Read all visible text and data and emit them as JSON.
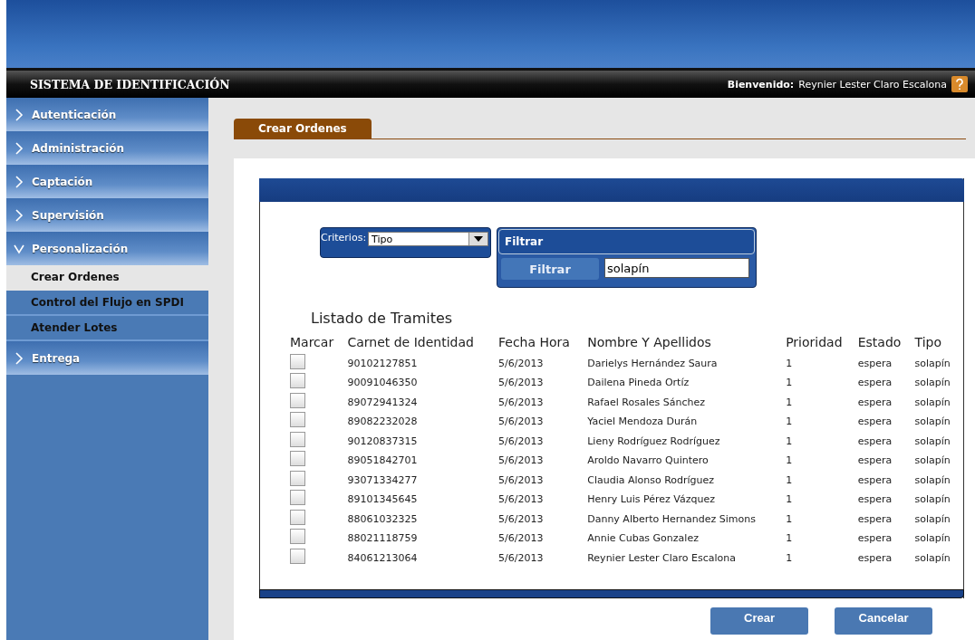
{
  "header": {
    "title": "SISTEMA DE IDENTIFICACIÓN",
    "welcome_label": "Bienvenido:",
    "user": "Reynier Lester Claro Escalona"
  },
  "sidebar": {
    "items": [
      {
        "label": "Autenticación",
        "expanded": false
      },
      {
        "label": "Administración",
        "expanded": false
      },
      {
        "label": "Captación",
        "expanded": false
      },
      {
        "label": "Supervisión",
        "expanded": false
      },
      {
        "label": "Personalización",
        "expanded": true,
        "children": [
          {
            "label": "Crear Ordenes",
            "selected": true
          },
          {
            "label": "Control del Flujo en SPDI",
            "selected": false
          },
          {
            "label": "Atender Lotes",
            "selected": false
          }
        ]
      },
      {
        "label": "Entrega",
        "expanded": false
      }
    ]
  },
  "tabs": [
    {
      "label": "Crear Ordenes",
      "selected": true
    }
  ],
  "criteria": {
    "label": "Criterios:",
    "value": "Tipo"
  },
  "filter": {
    "title": "Filtrar",
    "button": "Filtrar",
    "value": "solapín"
  },
  "table": {
    "title": "Listado de Tramites",
    "columns": [
      "Marcar",
      "Carnet de Identidad",
      "Fecha Hora",
      "Nombre Y Apellidos",
      "Prioridad",
      "Estado",
      "Tipo"
    ],
    "rows": [
      {
        "checked": false,
        "carnet": "90102127851",
        "fecha": "5/6/2013",
        "nombre": "Darielys Hernández Saura",
        "prioridad": "1",
        "estado": "espera",
        "tipo": "solapín"
      },
      {
        "checked": false,
        "carnet": "90091046350",
        "fecha": "5/6/2013",
        "nombre": "Dailena Pineda Ortíz",
        "prioridad": "1",
        "estado": "espera",
        "tipo": "solapín"
      },
      {
        "checked": false,
        "carnet": "89072941324",
        "fecha": "5/6/2013",
        "nombre": "Rafael Rosales Sánchez",
        "prioridad": "1",
        "estado": "espera",
        "tipo": "solapín"
      },
      {
        "checked": false,
        "carnet": "89082232028",
        "fecha": "5/6/2013",
        "nombre": "Yaciel Mendoza Durán",
        "prioridad": "1",
        "estado": "espera",
        "tipo": "solapín"
      },
      {
        "checked": false,
        "carnet": "90120837315",
        "fecha": "5/6/2013",
        "nombre": "Lieny Rodríguez Rodríguez",
        "prioridad": "1",
        "estado": "espera",
        "tipo": "solapín"
      },
      {
        "checked": false,
        "carnet": "89051842701",
        "fecha": "5/6/2013",
        "nombre": "Aroldo Navarro Quintero",
        "prioridad": "1",
        "estado": "espera",
        "tipo": "solapín"
      },
      {
        "checked": false,
        "carnet": "93071334277",
        "fecha": "5/6/2013",
        "nombre": "Claudia Alonso Rodríguez",
        "prioridad": "1",
        "estado": "espera",
        "tipo": "solapín"
      },
      {
        "checked": false,
        "carnet": "89101345645",
        "fecha": "5/6/2013",
        "nombre": "Henry Luis Pérez Vázquez",
        "prioridad": "1",
        "estado": "espera",
        "tipo": "solapín"
      },
      {
        "checked": false,
        "carnet": "88061032325",
        "fecha": "5/6/2013",
        "nombre": "Danny Alberto Hernandez Simons",
        "prioridad": "1",
        "estado": "espera",
        "tipo": "solapín"
      },
      {
        "checked": false,
        "carnet": "88021118759",
        "fecha": "5/6/2013",
        "nombre": "Annie Cubas Gonzalez",
        "prioridad": "1",
        "estado": "espera",
        "tipo": "solapín"
      },
      {
        "checked": false,
        "carnet": "84061213064",
        "fecha": "5/6/2013",
        "nombre": "Reynier Lester Claro Escalona",
        "prioridad": "1",
        "estado": "espera",
        "tipo": "solapín"
      }
    ]
  },
  "buttons": [
    "Crear",
    "Cancelar"
  ]
}
